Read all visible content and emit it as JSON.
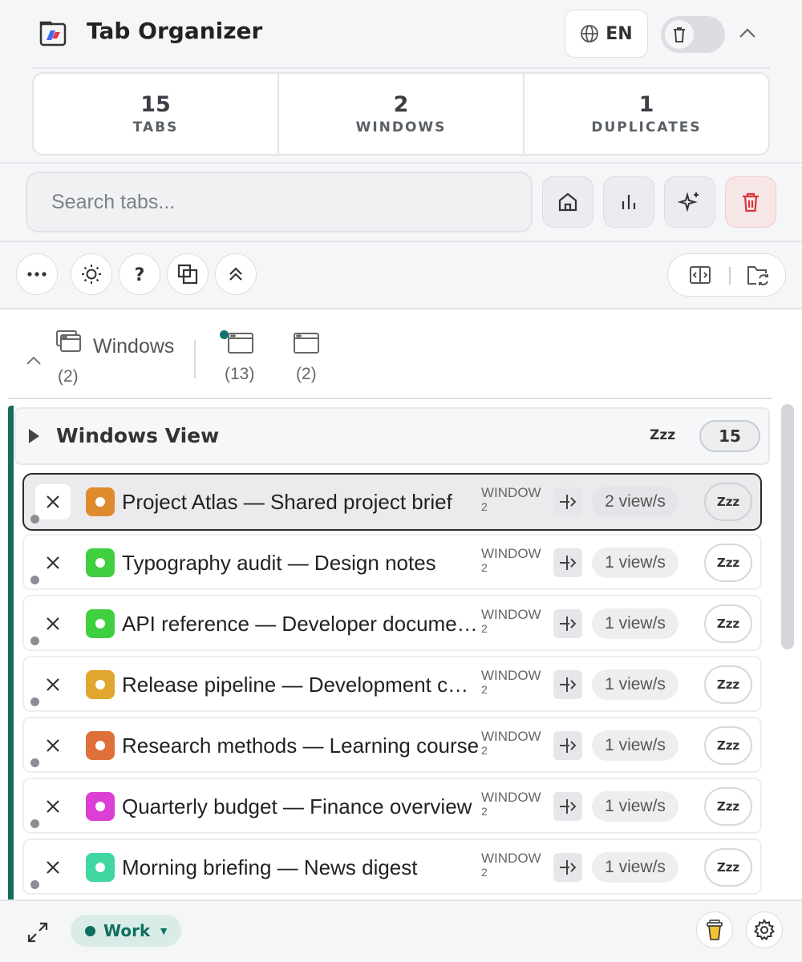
{
  "header": {
    "title": "Tab Organizer",
    "language": "EN"
  },
  "stats": [
    {
      "value": "15",
      "label": "TABS"
    },
    {
      "value": "2",
      "label": "WINDOWS"
    },
    {
      "value": "1",
      "label": "DUPLICATES"
    }
  ],
  "search": {
    "placeholder": "Search tabs..."
  },
  "toolbar_icons": [
    "home-icon",
    "bar-chart-icon",
    "sparkles-icon",
    "trash-icon"
  ],
  "controls_icons": [
    "more-icon",
    "sun-icon",
    "help-icon",
    "copy-icon",
    "chevrons-up-icon",
    "split-view-icon",
    "folder-sync-icon"
  ],
  "windows_tabs": {
    "label": "Windows",
    "all_count": "(2)",
    "window1_count": "(13)",
    "window2_count": "(2)"
  },
  "windows_view": {
    "title": "Windows View",
    "zzz": "Zzz",
    "count": "15"
  },
  "tabs": [
    {
      "title": "Project Atlas — Shared project brief",
      "window_label": "WINDOW",
      "window_num": "2",
      "views": "2 view/s",
      "zzz": "Zzz",
      "color": "#e08a2e",
      "selected": true
    },
    {
      "title": "Typography audit — Design notes",
      "window_label": "WINDOW",
      "window_num": "2",
      "views": "1 view/s",
      "zzz": "Zzz",
      "color": "#3fcf3f",
      "selected": false
    },
    {
      "title": "API reference — Developer documentation",
      "window_label": "WINDOW",
      "window_num": "2",
      "views": "1 view/s",
      "zzz": "Zzz",
      "color": "#3fcf3f",
      "selected": false
    },
    {
      "title": "Release pipeline — Development checklist",
      "window_label": "WINDOW",
      "window_num": "2",
      "views": "1 view/s",
      "zzz": "Zzz",
      "color": "#e0a62e",
      "selected": false
    },
    {
      "title": "Research methods — Learning course",
      "window_label": "WINDOW",
      "window_num": "2",
      "views": "1 view/s",
      "zzz": "Zzz",
      "color": "#e0703a",
      "selected": false
    },
    {
      "title": "Quarterly budget — Finance overview",
      "window_label": "WINDOW",
      "window_num": "2",
      "views": "1 view/s",
      "zzz": "Zzz",
      "color": "#dc3fd3",
      "selected": false
    },
    {
      "title": "Morning briefing — News digest",
      "window_label": "WINDOW",
      "window_num": "2",
      "views": "1 view/s",
      "zzz": "Zzz",
      "color": "#3fd6a0",
      "selected": false
    }
  ],
  "footer": {
    "workspace": "Work",
    "workspace_caret": "▼"
  },
  "colors": {
    "accent": "#146c60",
    "danger": "#d9363e"
  }
}
